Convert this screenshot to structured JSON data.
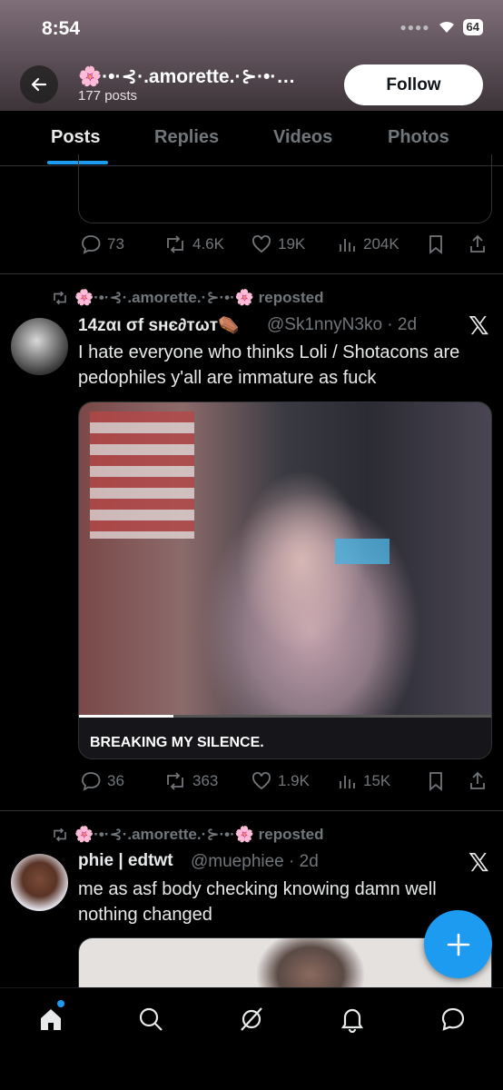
{
  "status_bar": {
    "time": "8:54",
    "battery": "64"
  },
  "header": {
    "profile_name": "🌸·•·⊰·.amorette.·⊱·•·…",
    "post_count": "177 posts",
    "follow_label": "Follow"
  },
  "tabs": [
    {
      "label": "Posts",
      "active": true
    },
    {
      "label": "Replies",
      "active": false
    },
    {
      "label": "Videos",
      "active": false
    },
    {
      "label": "Photos",
      "active": false
    }
  ],
  "post0": {
    "replies": "73",
    "reposts": "4.6K",
    "likes": "19K",
    "views": "204K"
  },
  "post1": {
    "repost_label": "🌸·•·⊰·.amorette.·⊱·•·🌸 reposted",
    "author": "14zαι σf ѕнє∂тωт⚰️",
    "handle": "@Sk1nnyN3ko · 2d",
    "text": "I hate everyone who thinks Loli / Shotacons are pedophiles y'all are immature as fuck",
    "media_caption": "BREAKING MY SILENCE.",
    "replies": "36",
    "reposts": "363",
    "likes": "1.9K",
    "views": "15K"
  },
  "post2": {
    "repost_label": "🌸·•·⊰·.amorette.·⊱·•·🌸 reposted",
    "author": "phie | edtwt",
    "handle": "@muephiee · 2d",
    "text": "me as asf body checking knowing damn well nothing changed"
  },
  "icons": {
    "back": "arrow-left-icon",
    "x_logo": "x-logo-icon",
    "reply": "speech-bubble-icon",
    "repost": "repost-icon",
    "like": "heart-icon",
    "views": "bar-chart-icon",
    "bookmark": "bookmark-icon",
    "share": "share-icon",
    "compose": "plus-icon",
    "home": "home-icon",
    "search": "search-icon",
    "grok": "grok-icon",
    "notifications": "bell-icon",
    "messages": "message-icon"
  },
  "colors": {
    "accent": "#1d9bf0",
    "background": "#000000",
    "text": "#e7e9ea",
    "muted": "#71767b"
  }
}
